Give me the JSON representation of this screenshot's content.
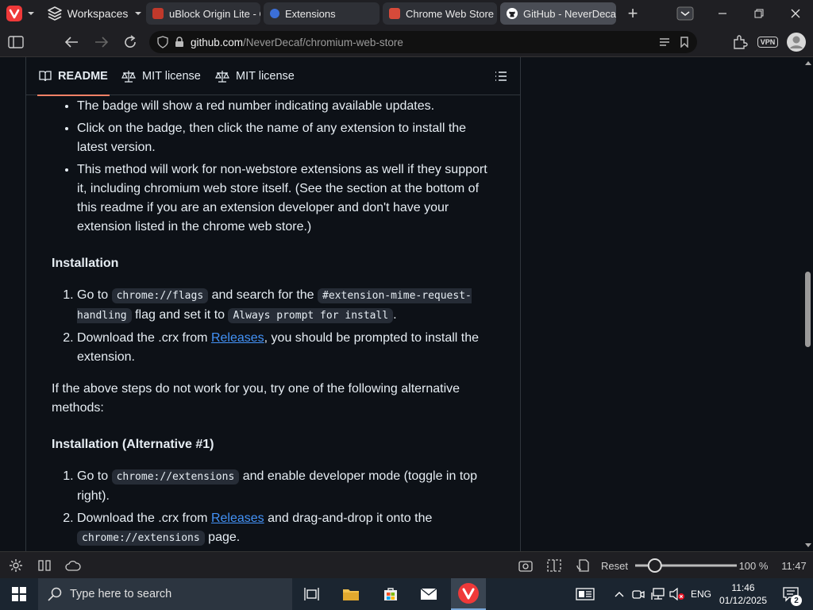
{
  "browser": {
    "workspaces_label": "Workspaces",
    "tabs": [
      {
        "title": "uBlock Origin Lite - C",
        "active": false,
        "favicon_color": "#c0392b"
      },
      {
        "title": "Extensions",
        "active": false,
        "favicon_color": "#3b6fd8"
      },
      {
        "title": "Chrome Web Store -",
        "active": false,
        "favicon_color": "#d64a3a"
      },
      {
        "title": "GitHub - NeverDecaf",
        "active": true,
        "favicon_color": "#ffffff"
      }
    ],
    "url_domain": "github.com",
    "url_path": "/NeverDecaf/chromium-web-store",
    "vpn_label": "VPN"
  },
  "readme_tabs": [
    {
      "label": "README",
      "icon": "book-icon"
    },
    {
      "label": "MIT license",
      "icon": "scale-icon"
    },
    {
      "label": "MIT license",
      "icon": "scale-icon"
    }
  ],
  "content": {
    "bullets": [
      "The badge will show a red number indicating available updates.",
      "Click on the badge, then click the name of any extension to install the latest version.",
      "This method will work for non-webstore extensions as well if they support it, including chromium web store itself. (See the section at the bottom of this readme if you are an extension developer and don't have your extension listed in the chrome web store.)"
    ],
    "installation_heading": "Installation",
    "install_step1_a": "Go to ",
    "install_step1_code1": "chrome://flags",
    "install_step1_b": " and search for the ",
    "install_step1_code2": "#extension-mime-request-handling",
    "install_step1_c": " flag and set it to ",
    "install_step1_code3": "Always prompt for install",
    "install_step1_d": ".",
    "install_step2_a": "Download the .crx from ",
    "install_step2_link": "Releases",
    "install_step2_b": ", you should be prompted to install the extension.",
    "alt_paragraph": "If the above steps do not work for you, try one of the following alternative methods:",
    "alt1_heading": "Installation (Alternative #1)",
    "alt1_step1_a": "Go to ",
    "alt1_step1_code": "chrome://extensions",
    "alt1_step1_b": " and enable developer mode (toggle in top right).",
    "alt1_step2_a": "Download the .crx from ",
    "alt1_step2_link": "Releases",
    "alt1_step2_b": " and drag-and-drop it onto the ",
    "alt1_step2_code": "chrome://extensions",
    "alt1_step2_c": " page."
  },
  "statusbar": {
    "reset_label": "Reset",
    "zoom": "100 %",
    "zoom_level": 0.5,
    "clock": "11:47"
  },
  "taskbar": {
    "search_placeholder": "Type here to search",
    "lang": "ENG",
    "time": "11:46",
    "date": "01/12/2025",
    "notification_count": "2"
  }
}
